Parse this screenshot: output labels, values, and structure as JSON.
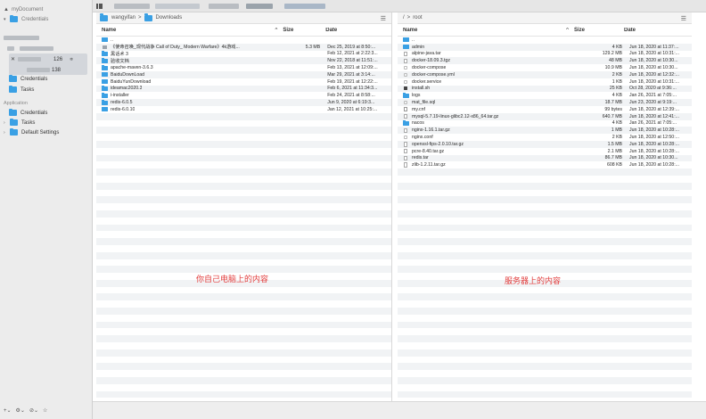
{
  "sidebar": {
    "workspace_title": "myDocument",
    "group_title": "Credentials",
    "credentials_label": "Credentials",
    "tasks_label": "Tasks",
    "section_label": "Application",
    "app_credentials_label": "Credentials",
    "app_tasks_label": "Tasks",
    "default_settings_label": "Default Settings",
    "selected_host_port": "126",
    "selected_host_sub": "138"
  },
  "left_pane": {
    "breadcrumb_root": "wangyifan",
    "breadcrumb_sep": ">",
    "breadcrumb_current": "Downloads",
    "columns": {
      "name": "Name",
      "size": "Size",
      "date": "Date",
      "sort_indicator": "^"
    },
    "rows": [
      {
        "icon": "folder",
        "name": "..",
        "size": "",
        "date": ""
      },
      {
        "icon": "shot",
        "name": "《使命召唤_现代战争 Call of Duty_ Modern Warfare》4k游戏...",
        "size": "5.3 MB",
        "date": "Dec 25, 2019 at 8:50:..."
      },
      {
        "icon": "folder",
        "name": "黑话术 3",
        "size": "",
        "date": "Feb 12, 2021 at 2:22:3..."
      },
      {
        "icon": "folder",
        "name": "验收文档",
        "size": "",
        "date": "Nov 22, 2018 at 11:51:..."
      },
      {
        "icon": "folder",
        "name": "apache-maven-3.6.3",
        "size": "",
        "date": "Feb 13, 2021 at 12:09:..."
      },
      {
        "icon": "folder",
        "name": "BaiduDownLoad",
        "size": "",
        "date": "Mar 29, 2021 at 3:14:..."
      },
      {
        "icon": "folder",
        "name": "BaiduYunDownload",
        "size": "",
        "date": "Feb 19, 2021 at 12:22:..."
      },
      {
        "icon": "folder",
        "name": "ideamac2020.3",
        "size": "",
        "date": "Feb 6, 2021 at 11:34:3..."
      },
      {
        "icon": "folder",
        "name": "i-installer",
        "size": "",
        "date": "Feb 24, 2021 at 8:58:..."
      },
      {
        "icon": "folder",
        "name": "redis-6.0.5",
        "size": "",
        "date": "Jun 9, 2020 at 6:19:3..."
      },
      {
        "icon": "folder",
        "name": "redis-6.0.10",
        "size": "",
        "date": "Jan 12, 2021 at 10:25:..."
      }
    ],
    "overlay_text": "你自己电脑上的内容"
  },
  "right_pane": {
    "breadcrumb_root": "/",
    "breadcrumb_sep": ">",
    "breadcrumb_current": "root",
    "columns": {
      "name": "Name",
      "size": "Size",
      "date": "Date",
      "sort_indicator": "^"
    },
    "rows": [
      {
        "icon": "folder",
        "name": "..",
        "size": "",
        "date": ""
      },
      {
        "icon": "folder",
        "name": "admin",
        "size": "4 KB",
        "date": "Jun 18, 2020 at 11:37:..."
      },
      {
        "icon": "file",
        "name": "alpine-java.tar",
        "size": "129.2 MB",
        "date": "Jun 18, 2020 at 10:31:..."
      },
      {
        "icon": "file",
        "name": "docker-18.09.3.tgz",
        "size": "48 MB",
        "date": "Jun 18, 2020 at 10:30..."
      },
      {
        "icon": "blank",
        "name": "docker-compose",
        "size": "10.9 MB",
        "date": "Jun 18, 2020 at 10:30..."
      },
      {
        "icon": "blank",
        "name": "docker-compose.yml",
        "size": "2 KB",
        "date": "Jun 18, 2020 at 12:32:..."
      },
      {
        "icon": "blank",
        "name": "docker.service",
        "size": "1 KB",
        "date": "Jun 18, 2020 at 10:31:..."
      },
      {
        "icon": "exec",
        "name": "install.sh",
        "size": "25 KB",
        "date": "Oct 28, 2020 at 9:36:..."
      },
      {
        "icon": "folder",
        "name": "logs",
        "size": "4 KB",
        "date": "Jan 26, 2021 at 7:05:..."
      },
      {
        "icon": "blank",
        "name": "mat_file.sql",
        "size": "18.7 MB",
        "date": "Jun 23, 2020 at 9:19:..."
      },
      {
        "icon": "excl",
        "name": "my.cnf",
        "size": "99 bytes",
        "date": "Jun 18, 2020 at 12:39:..."
      },
      {
        "icon": "file",
        "name": "mysql-5.7.19-linux-glibc2.12-x86_64.tar.gz",
        "size": "640.7 MB",
        "date": "Jun 18, 2020 at 12:41:..."
      },
      {
        "icon": "folder",
        "name": "nacos",
        "size": "4 KB",
        "date": "Jan 26, 2021 at 7:05:..."
      },
      {
        "icon": "file",
        "name": "nginx-1.16.1.tar.gz",
        "size": "1 MB",
        "date": "Jun 18, 2020 at 10:28:..."
      },
      {
        "icon": "blank",
        "name": "nginx.conf",
        "size": "2 KB",
        "date": "Jun 18, 2020 at 12:50:..."
      },
      {
        "icon": "file",
        "name": "openssl-fips-2.0.10.tar.gz",
        "size": "1.5 MB",
        "date": "Jun 18, 2020 at 10:28:..."
      },
      {
        "icon": "file",
        "name": "pcre-8.40.tar.gz",
        "size": "2.1 MB",
        "date": "Jun 18, 2020 at 10:28:..."
      },
      {
        "icon": "file",
        "name": "redis.tar",
        "size": "86.7 MB",
        "date": "Jun 18, 2020 at 10:30..."
      },
      {
        "icon": "file",
        "name": "zlib-1.2.11.tar.gz",
        "size": "608 KB",
        "date": "Jun 18, 2020 at 10:28:..."
      }
    ],
    "overlay_text": "服务器上的内容"
  },
  "colors": {
    "accent": "#3aa0e4",
    "overlay_text": "#e23d3d",
    "row_alt": "#f1f3f5"
  }
}
